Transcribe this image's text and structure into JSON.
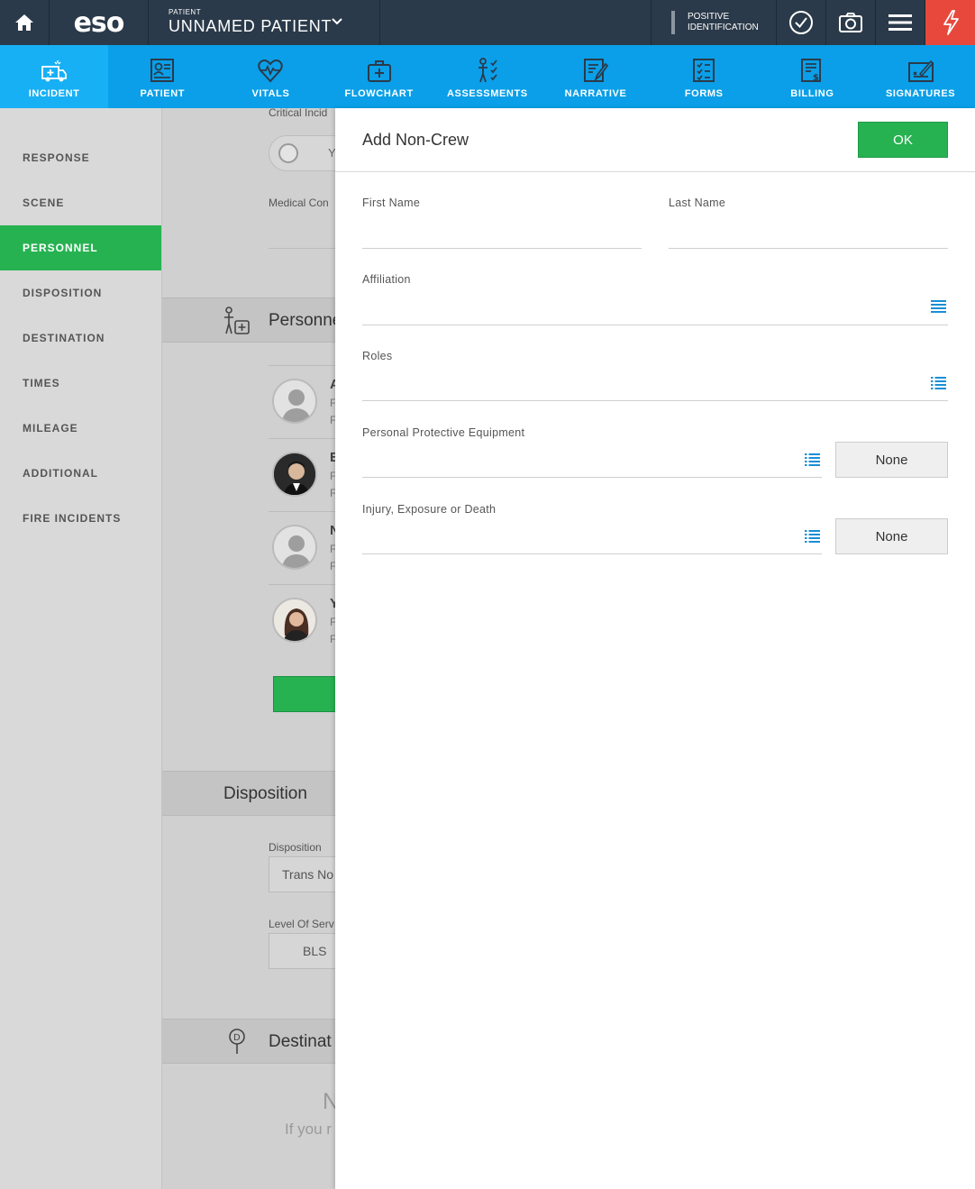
{
  "topbar": {
    "logo": "eso",
    "patient_caption": "PATIENT",
    "patient_name": "UNNAMED PATIENT",
    "positive_id_line1": "POSITIVE",
    "positive_id_line2": "IDENTIFICATION",
    "icons": [
      "home-icon",
      "chevron-down-icon",
      "checkmark-circle-icon",
      "camera-icon",
      "hamburger-menu-icon",
      "flash-icon"
    ]
  },
  "nav": {
    "tabs": [
      {
        "label": "INCIDENT",
        "icon": "ambulance-icon",
        "active": true
      },
      {
        "label": "PATIENT",
        "icon": "patient-card-icon"
      },
      {
        "label": "VITALS",
        "icon": "heart-pulse-icon"
      },
      {
        "label": "FLOWCHART",
        "icon": "medical-bag-icon"
      },
      {
        "label": "ASSESSMENTS",
        "icon": "body-checklist-icon"
      },
      {
        "label": "NARRATIVE",
        "icon": "pencil-document-icon"
      },
      {
        "label": "FORMS",
        "icon": "checklist-icon"
      },
      {
        "label": "BILLING",
        "icon": "billing-document-icon"
      },
      {
        "label": "SIGNATURES",
        "icon": "signature-icon"
      }
    ]
  },
  "sidebar": {
    "items": [
      {
        "label": "RESPONSE"
      },
      {
        "label": "SCENE"
      },
      {
        "label": "PERSONNEL",
        "active": true
      },
      {
        "label": "DISPOSITION"
      },
      {
        "label": "DESTINATION"
      },
      {
        "label": "TIMES"
      },
      {
        "label": "MILEAGE"
      },
      {
        "label": "ADDITIONAL"
      },
      {
        "label": "FIRE INCIDENTS"
      }
    ]
  },
  "background": {
    "critical_incident_label": "Critical Incid",
    "toggle_text": "Y",
    "medical_label": "Medical Con",
    "personnel_title": "Personne",
    "crew_initials": [
      "A",
      "E",
      "N",
      "Y"
    ],
    "crew_sub": "F",
    "disposition_title": "Disposition",
    "disposition_label": "Disposition",
    "disposition_value": "Trans No",
    "level_label": "Level Of Serv",
    "level_value": "BLS",
    "destination_title": "Destinat",
    "empty_big": "N",
    "empty_hint": "If you r"
  },
  "panel": {
    "title": "Add Non-Crew",
    "ok_label": "OK",
    "fields": {
      "first_name": {
        "label": "First Name",
        "value": ""
      },
      "last_name": {
        "label": "Last Name",
        "value": ""
      },
      "affiliation": {
        "label": "Affiliation",
        "value": ""
      },
      "roles": {
        "label": "Roles",
        "value": ""
      },
      "ppe": {
        "label": "Personal Protective Equipment",
        "value": "",
        "none_label": "None"
      },
      "injury": {
        "label": "Injury, Exposure or Death",
        "value": "",
        "none_label": "None"
      }
    }
  },
  "colors": {
    "topbar": "#2b3a4a",
    "nav": "#0a9fe8",
    "active_green": "#27b252",
    "flash_red": "#e8483c",
    "list_icon_blue": "#1a8fd6"
  }
}
